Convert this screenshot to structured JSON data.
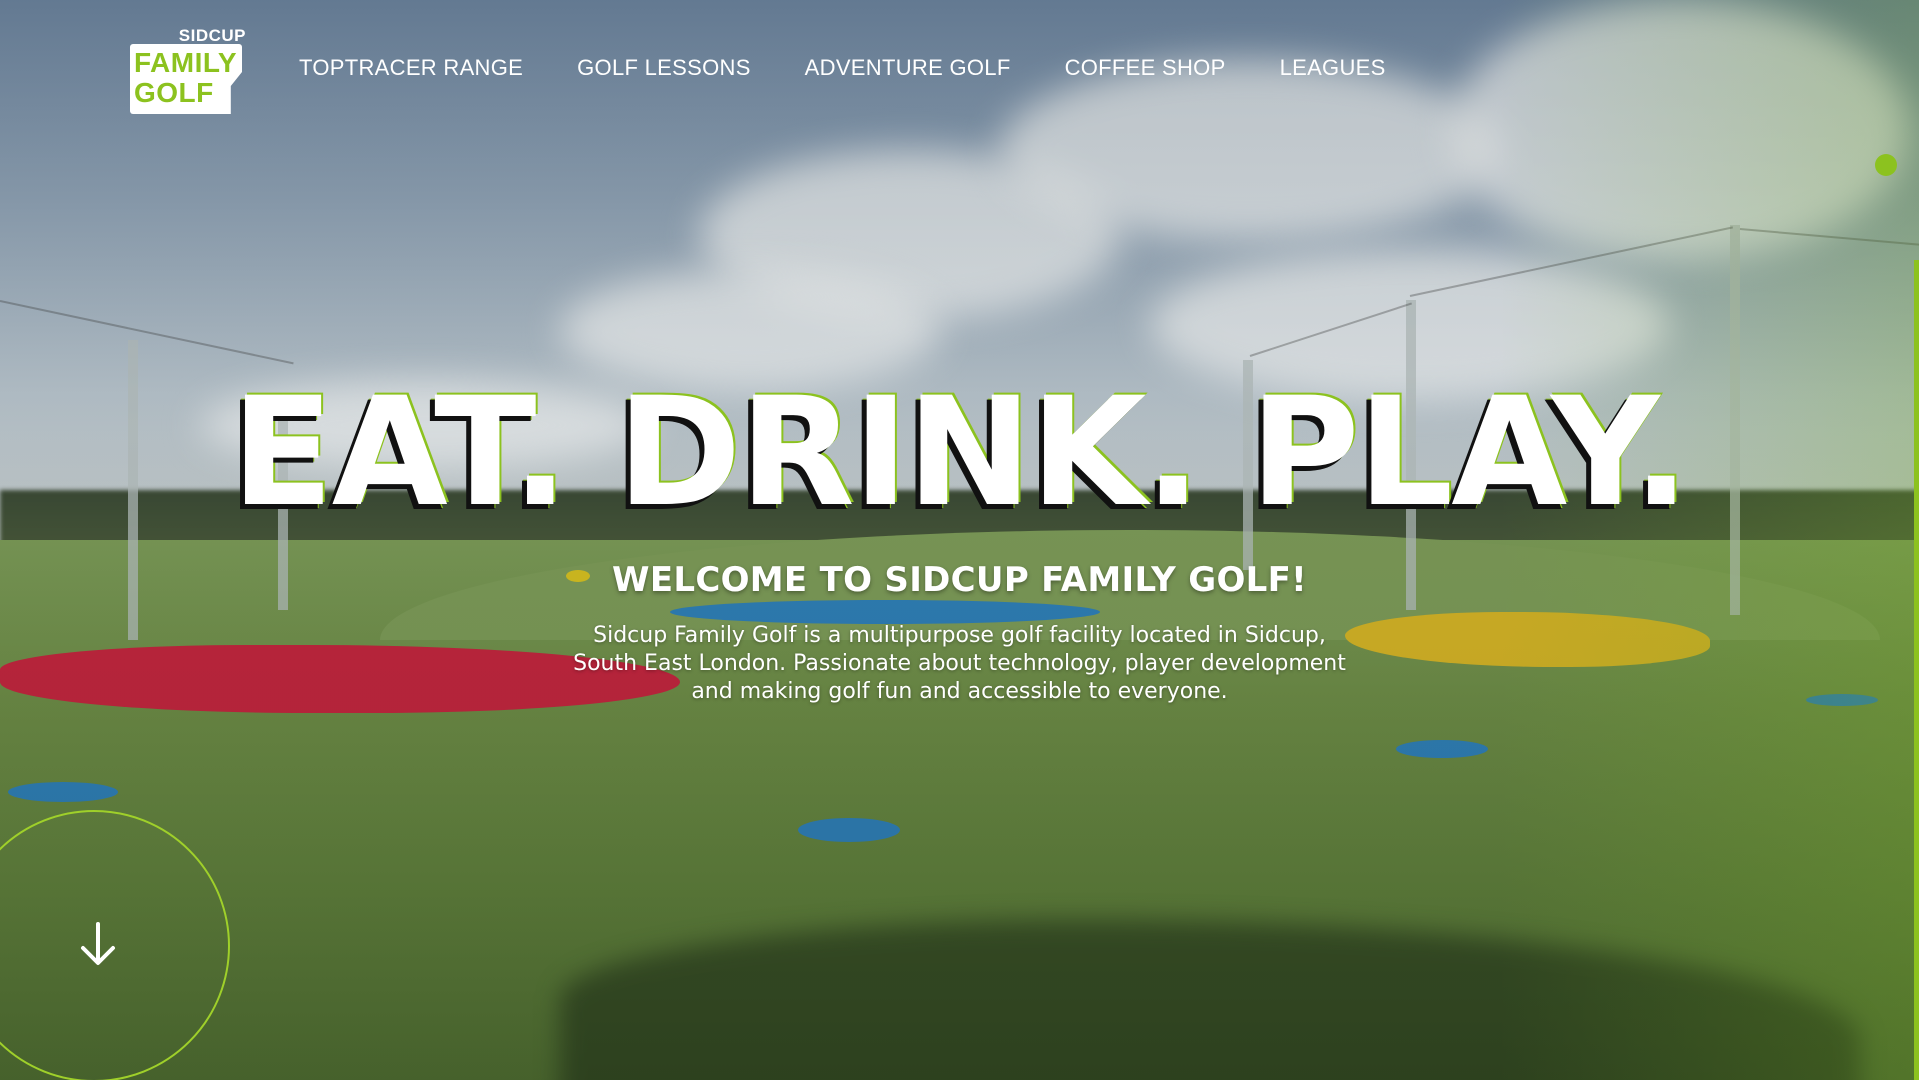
{
  "logo": {
    "top": "SIDCUP",
    "line1": "FAMILY",
    "line2": "GOLF"
  },
  "nav": {
    "items": [
      {
        "label": "TOPTRACER RANGE"
      },
      {
        "label": "GOLF LESSONS"
      },
      {
        "label": "ADVENTURE GOLF"
      },
      {
        "label": "COFFEE SHOP"
      },
      {
        "label": "LEAGUES"
      }
    ]
  },
  "hero": {
    "title": "EAT. DRINK. PLAY.",
    "subtitle": "WELCOME TO SIDCUP FAMILY GOLF!",
    "description": "Sidcup Family Golf is a multipurpose golf facility located in Sidcup, South East London. Passionate about technology, player development and making golf fun and accessible to everyone."
  },
  "colors": {
    "accent": "#8cc21f",
    "text": "#ffffff"
  },
  "icons": {
    "scroll_down": "arrow-down-icon",
    "side_indicator": "dot-indicator-icon"
  }
}
